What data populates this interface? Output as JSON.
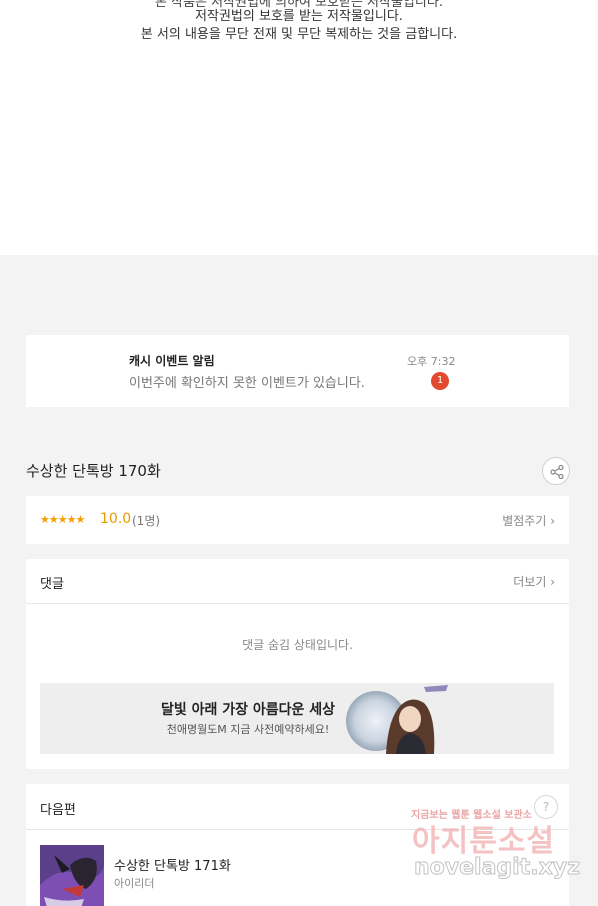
{
  "copyright": {
    "line0_partial": "본 작품은 저작권법에 의하여 보호받는 저작물입니다.",
    "line1": "저작권법의 보호를 받는 저작물입니다.",
    "line2": "본 서의 내용을 무단 전재 및 무단 복제하는 것을 금합니다."
  },
  "notification": {
    "title": "캐시 이벤트 알림",
    "message": "이번주에 확인하지 못한 이벤트가 있습니다.",
    "time": "오후 7:32",
    "badge": "1"
  },
  "episode": {
    "title": "수상한 단톡방 170화",
    "share_icon": "share-icon"
  },
  "rating": {
    "stars": "★★★★★",
    "score": "10.0",
    "count": "(1명)",
    "rate_link": "별점주기 ›"
  },
  "comments": {
    "title": "댓글",
    "more": "더보기 ›",
    "hidden_msg": "댓글 숨김 상태입니다."
  },
  "banner": {
    "title": "달빛 아래 가장 아름다운 세상",
    "subtitle": "천애명월도M 지금 사전예약하세요!"
  },
  "next": {
    "title": "다음편",
    "episode": "수상한 단톡방 171화",
    "author": "아이리더",
    "info_icon": "?"
  },
  "watermark": {
    "small": "지금보는 웹툰 웹소설 보관소",
    "big": "아지툰소설",
    "url": "novelagit.xyz"
  },
  "colors": {
    "accent_orange": "#e89b00",
    "badge_red": "#e2492e",
    "page_bg": "#f3f3f3"
  }
}
